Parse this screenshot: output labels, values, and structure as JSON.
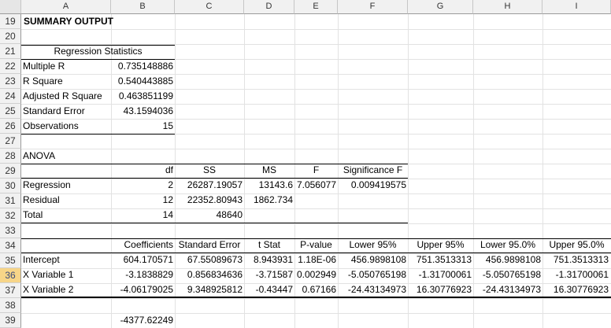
{
  "columns": [
    "A",
    "B",
    "C",
    "D",
    "E",
    "F",
    "G",
    "H",
    "I"
  ],
  "rows": [
    "19",
    "20",
    "21",
    "22",
    "23",
    "24",
    "25",
    "26",
    "27",
    "28",
    "29",
    "30",
    "31",
    "32",
    "33",
    "34",
    "35",
    "36",
    "37",
    "38",
    "39"
  ],
  "summary_title": "SUMMARY OUTPUT",
  "regression_statistics": {
    "header": "Regression Statistics",
    "rows": [
      {
        "label": "Multiple R",
        "value": "0.735148886"
      },
      {
        "label": "R Square",
        "value": "0.540443885"
      },
      {
        "label": "Adjusted R Square",
        "value": "0.463851199"
      },
      {
        "label": "Standard Error",
        "value": "43.1594036"
      },
      {
        "label": "Observations",
        "value": "15"
      }
    ]
  },
  "anova": {
    "title": "ANOVA",
    "headers": [
      "df",
      "SS",
      "MS",
      "F",
      "Significance F"
    ],
    "rows": [
      {
        "label": "Regression",
        "values": [
          "2",
          "26287.19057",
          "13143.6",
          "7.056077",
          "0.009419575"
        ]
      },
      {
        "label": "Residual",
        "values": [
          "12",
          "22352.80943",
          "1862.734",
          "",
          ""
        ]
      },
      {
        "label": "Total",
        "values": [
          "14",
          "48640",
          "",
          "",
          ""
        ]
      }
    ]
  },
  "coefficients": {
    "headers": [
      "Coefficients",
      "Standard Error",
      "t Stat",
      "P-value",
      "Lower 95%",
      "Upper 95%",
      "Lower 95.0%",
      "Upper 95.0%"
    ],
    "rows": [
      {
        "label": "Intercept",
        "values": [
          "604.170571",
          "67.55089673",
          "8.943931",
          "1.18E-06",
          "456.9898108",
          "751.3513313",
          "456.9898108",
          "751.3513313"
        ]
      },
      {
        "label": "X Variable 1",
        "values": [
          "-3.1838829",
          "0.856834636",
          "-3.71587",
          "0.002949",
          "-5.050765198",
          "-1.31700061",
          "-5.050765198",
          "-1.31700061"
        ]
      },
      {
        "label": "X Variable 2",
        "values": [
          "-4.06179025",
          "9.348925812",
          "-0.43447",
          "0.67166",
          "-24.43134973",
          "16.30776923",
          "-24.43134973",
          "16.30776923"
        ]
      }
    ]
  },
  "cell_b39": "-4377.62249",
  "active_row": "36"
}
